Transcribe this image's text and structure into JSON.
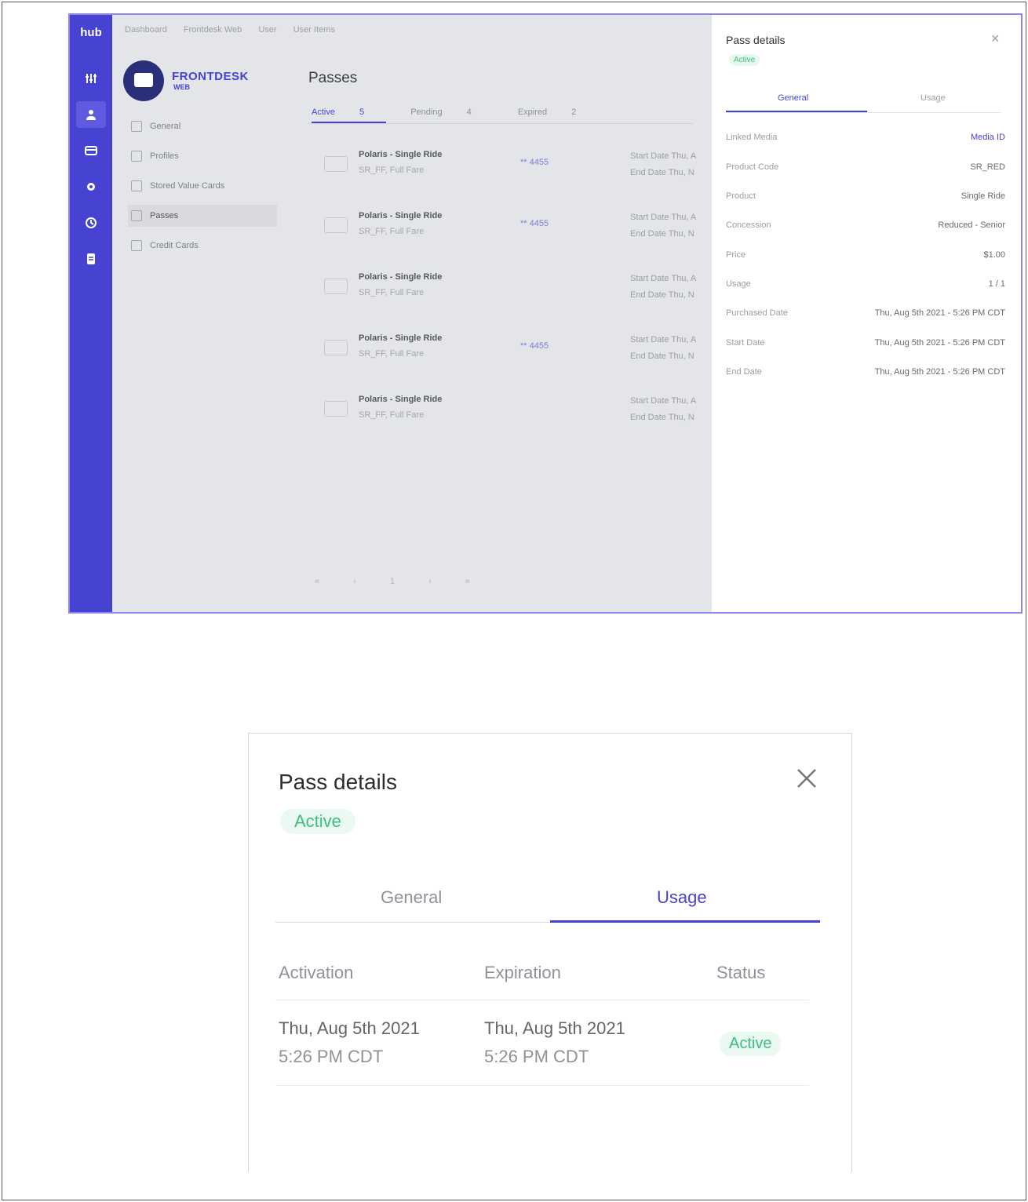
{
  "colors": {
    "accent": "#4643d3",
    "success": "#3cbf80",
    "rail": "#4643d3"
  },
  "app": {
    "brand": "hub",
    "breadcrumbs": [
      "Dashboard",
      "Frontdesk Web",
      "User",
      "User Items"
    ],
    "logo": {
      "title": "FRONTDESK",
      "subtitle": "WEB"
    },
    "rail_icons": [
      "sliders-icon",
      "user-icon",
      "card-icon",
      "gear-icon",
      "history-icon",
      "document-icon"
    ],
    "nav": [
      {
        "label": "General",
        "icon": "info-icon"
      },
      {
        "label": "Profiles",
        "icon": "profile-icon"
      },
      {
        "label": "Stored Value Cards",
        "icon": "wallet-icon"
      },
      {
        "label": "Passes",
        "icon": "pass-icon",
        "selected": true
      },
      {
        "label": "Credit Cards",
        "icon": "credit-card-icon"
      }
    ],
    "page_title": "Passes",
    "tabs": [
      {
        "label": "Active",
        "count": "5"
      },
      {
        "label": "Pending",
        "count": "4"
      },
      {
        "label": "Expired",
        "count": "2"
      }
    ],
    "passes": [
      {
        "name": "Polaris - Single Ride",
        "sub": "SR_FF, Full Fare",
        "media": "** 4455",
        "start": "Start Date  Thu, A",
        "end": "End Date  Thu, N"
      },
      {
        "name": "Polaris - Single Ride",
        "sub": "SR_FF, Full Fare",
        "media": "** 4455",
        "start": "Start Date  Thu, A",
        "end": "End Date  Thu, N"
      },
      {
        "name": "Polaris - Single Ride",
        "sub": "SR_FF, Full Fare",
        "media": "",
        "start": "Start Date  Thu, A",
        "end": "End Date  Thu, N"
      },
      {
        "name": "Polaris - Single Ride",
        "sub": "SR_FF, Full Fare",
        "media": "** 4455",
        "start": "Start Date  Thu, A",
        "end": "End Date  Thu, N"
      },
      {
        "name": "Polaris - Single Ride",
        "sub": "SR_FF, Full Fare",
        "media": "",
        "start": "Start Date  Thu, A",
        "end": "End Date  Thu, N"
      }
    ],
    "pager": "« ‹ 1 › »"
  },
  "drawer": {
    "title": "Pass details",
    "status": "Active",
    "close": "×",
    "tab_general": "General",
    "tab_usage": "Usage",
    "fields": [
      {
        "key": "Linked Media",
        "value": "Media ID",
        "link": true
      },
      {
        "key": "Product Code",
        "value": "SR_RED"
      },
      {
        "key": "Product",
        "value": "Single Ride"
      },
      {
        "key": "Concession",
        "value": "Reduced - Senior"
      },
      {
        "key": "Price",
        "value": "$1.00"
      },
      {
        "key": "Usage",
        "value": "1 / 1"
      },
      {
        "key": "Purchased Date",
        "value": "Thu, Aug 5th 2021 - 5:26 PM CDT"
      },
      {
        "key": "Start Date",
        "value": "Thu, Aug 5th 2021 - 5:26 PM CDT"
      },
      {
        "key": "End Date",
        "value": "Thu, Aug 5th 2021 - 5:26 PM CDT"
      }
    ]
  },
  "zoom": {
    "title": "Pass details",
    "status": "Active",
    "tab_general": "General",
    "tab_usage": "Usage",
    "headers": {
      "activation": "Activation",
      "expiration": "Expiration",
      "status": "Status"
    },
    "row": {
      "activation_date": "Thu, Aug 5th 2021",
      "activation_time": "5:26 PM CDT",
      "expiration_date": "Thu, Aug 5th 2021",
      "expiration_time": "5:26 PM CDT",
      "status": "Active"
    }
  }
}
